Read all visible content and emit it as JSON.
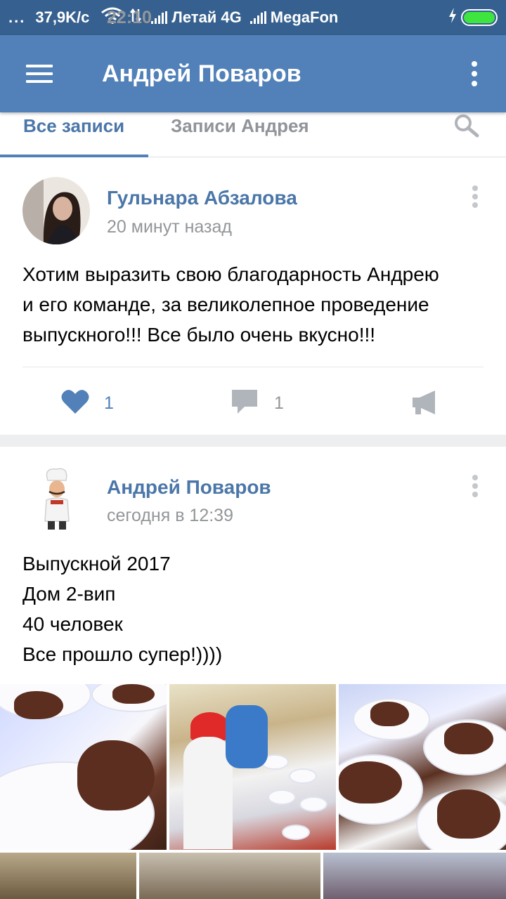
{
  "statusbar": {
    "time": "22:10",
    "dots": "...",
    "speed": "37,9K/c",
    "carrier1": "Летай 4G",
    "carrier2": "MegaFon",
    "battery_color": "#3ee53e"
  },
  "appbar": {
    "title": "Андрей Поваров",
    "menu_icon": "hamburger-icon",
    "more_icon": "more-vertical-icon"
  },
  "tabs": [
    {
      "label": "Все записи",
      "active": true
    },
    {
      "label": "Записи Андрея",
      "active": false
    }
  ],
  "colors": {
    "accent": "#5181b8",
    "link": "#4a76a8",
    "secondary_text": "#939699"
  },
  "posts": [
    {
      "author": "Гульнара Абзалова",
      "time": "20 минут назад",
      "text_lines": [
        "Хотим выразить свою благодарность Андрею",
        "и его команде, за великолепное проведение",
        "выпускного!!! Все было очень вкусно!!!"
      ],
      "likes": "1",
      "comments": "1",
      "liked": true
    },
    {
      "author": "Андрей Поваров",
      "time": "сегодня в 12:39",
      "text_lines": [
        "Выпускной 2017",
        "Дом 2-вип",
        "40 человек",
        "Все прошло супер!))))"
      ]
    }
  ]
}
